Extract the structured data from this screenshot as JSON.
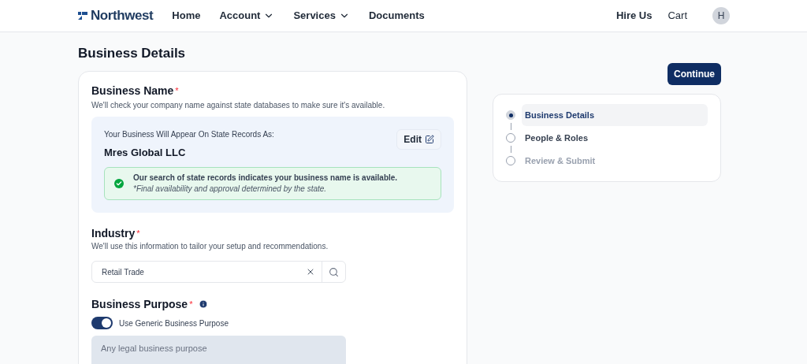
{
  "nav": {
    "logo": "Northwest",
    "items": [
      {
        "label": "Home",
        "dropdown": false
      },
      {
        "label": "Account",
        "dropdown": true
      },
      {
        "label": "Services",
        "dropdown": true
      },
      {
        "label": "Documents",
        "dropdown": false
      }
    ],
    "right": [
      {
        "label": "Hire Us",
        "bold": true
      },
      {
        "label": "Cart",
        "bold": false
      }
    ],
    "avatar": "H"
  },
  "page_title": "Business Details",
  "business_name": {
    "label": "Business Name",
    "required": "*",
    "hint": "We'll check your company name against state databases to make sure it's available.",
    "record_label": "Your Business Will Appear On State Records As:",
    "name": "Mres Global LLC",
    "edit_button": "Edit",
    "availability": {
      "message": "Our search of state records indicates your business name is available.",
      "note": "*Final availability and approval determined by the state."
    }
  },
  "industry": {
    "label": "Industry",
    "required": "*",
    "hint": "We'll use this information to tailor your setup and recommendations.",
    "value": "Retail Trade"
  },
  "business_purpose": {
    "label": "Business Purpose",
    "required": "*",
    "toggle": {
      "label": "Use Generic Business Purpose",
      "on": true
    },
    "placeholder": "Any legal business purpose",
    "disabled": true
  },
  "continue_button": "Continue",
  "steps": [
    {
      "label": "Business Details",
      "selected": true,
      "disabled": false
    },
    {
      "label": "People & Roles",
      "selected": false,
      "disabled": false
    },
    {
      "label": "Review & Submit",
      "selected": false,
      "disabled": true
    }
  ]
}
